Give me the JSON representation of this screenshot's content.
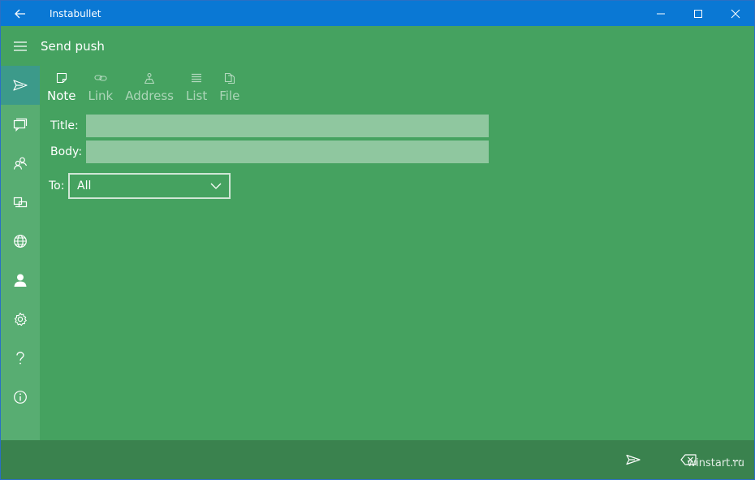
{
  "window": {
    "title": "Instabullet"
  },
  "header": {
    "title": "Send push"
  },
  "nav": {
    "items": [
      {
        "icon": "send-icon",
        "active": true
      },
      {
        "icon": "chat-icon",
        "active": false
      },
      {
        "icon": "people-icon",
        "active": false
      },
      {
        "icon": "devices-icon",
        "active": false
      },
      {
        "icon": "globe-icon",
        "active": false
      },
      {
        "icon": "person-icon",
        "active": false
      },
      {
        "icon": "gear-icon",
        "active": false
      },
      {
        "icon": "help-icon",
        "active": false
      },
      {
        "icon": "info-icon",
        "active": false
      }
    ]
  },
  "tabs": [
    {
      "label": "Note",
      "icon": "note-icon",
      "active": true
    },
    {
      "label": "Link",
      "icon": "link-icon",
      "active": false
    },
    {
      "label": "Address",
      "icon": "map-pin-icon",
      "active": false
    },
    {
      "label": "List",
      "icon": "list-icon",
      "active": false
    },
    {
      "label": "File",
      "icon": "file-icon",
      "active": false
    }
  ],
  "form": {
    "title_label": "Title:",
    "title_value": "",
    "body_label": "Body:",
    "body_value": "",
    "to_label": "To:",
    "to_selected": "All"
  },
  "bottombar": {
    "send_icon": "send-icon",
    "clear_icon": "backspace-icon",
    "more_label": "..."
  },
  "watermark": "winstart.ru",
  "colors": {
    "titlebar": "#0a78d4",
    "background": "#45a260",
    "nav": "#58ad72",
    "nav_active": "#3c9a8a",
    "bottombar": "#3a824e",
    "input": "#8fc79f"
  }
}
